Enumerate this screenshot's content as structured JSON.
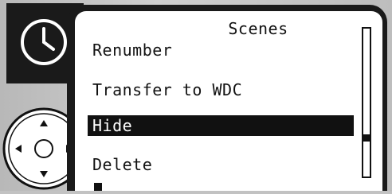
{
  "screen": {
    "title": "Scenes",
    "items": [
      {
        "label": "Renumber",
        "selected": false
      },
      {
        "label": "Transfer to WDC",
        "selected": false
      },
      {
        "label": "Hide",
        "selected": true
      },
      {
        "label": "Delete",
        "selected": false
      }
    ],
    "scrollbar": {
      "position_fraction": 0.75
    }
  },
  "icons": {
    "clock": "clock-icon",
    "nav": "navigation-pad-icon"
  },
  "colors": {
    "screen_bg": "#ffffff",
    "bezel": "#1a1a1a",
    "selection_bg": "#111111",
    "device_body": "#c2c2c2"
  }
}
